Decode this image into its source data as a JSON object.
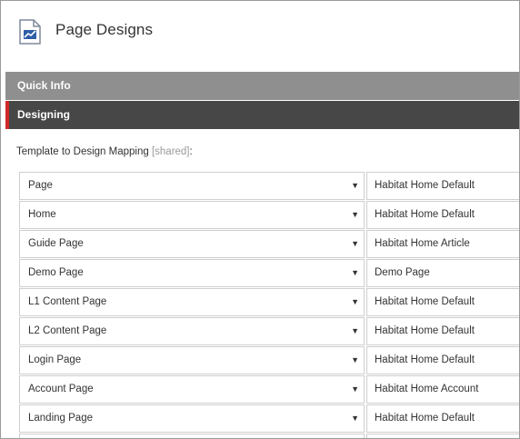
{
  "header": {
    "title": "Page Designs",
    "icon": "page-design-icon"
  },
  "sections": {
    "quick_info": "Quick Info",
    "designing": "Designing"
  },
  "field": {
    "label": "Template to Design Mapping",
    "shared": "[shared]",
    "colon": ":"
  },
  "mappings": [
    {
      "template": "Page",
      "design": "Habitat Home Default"
    },
    {
      "template": "Home",
      "design": "Habitat Home Default"
    },
    {
      "template": "Guide Page",
      "design": "Habitat Home Article"
    },
    {
      "template": "Demo Page",
      "design": "Demo Page"
    },
    {
      "template": "L1 Content Page",
      "design": "Habitat Home Default"
    },
    {
      "template": "L2 Content Page",
      "design": "Habitat Home Default"
    },
    {
      "template": "Login Page",
      "design": "Habitat Home Default"
    },
    {
      "template": "Account Page",
      "design": "Habitat Home Account"
    },
    {
      "template": "Landing Page",
      "design": "Habitat Home Default"
    }
  ],
  "colors": {
    "accent": "#d22a2a",
    "quick_bar": "#8f8f8f",
    "design_bar": "#474747"
  }
}
